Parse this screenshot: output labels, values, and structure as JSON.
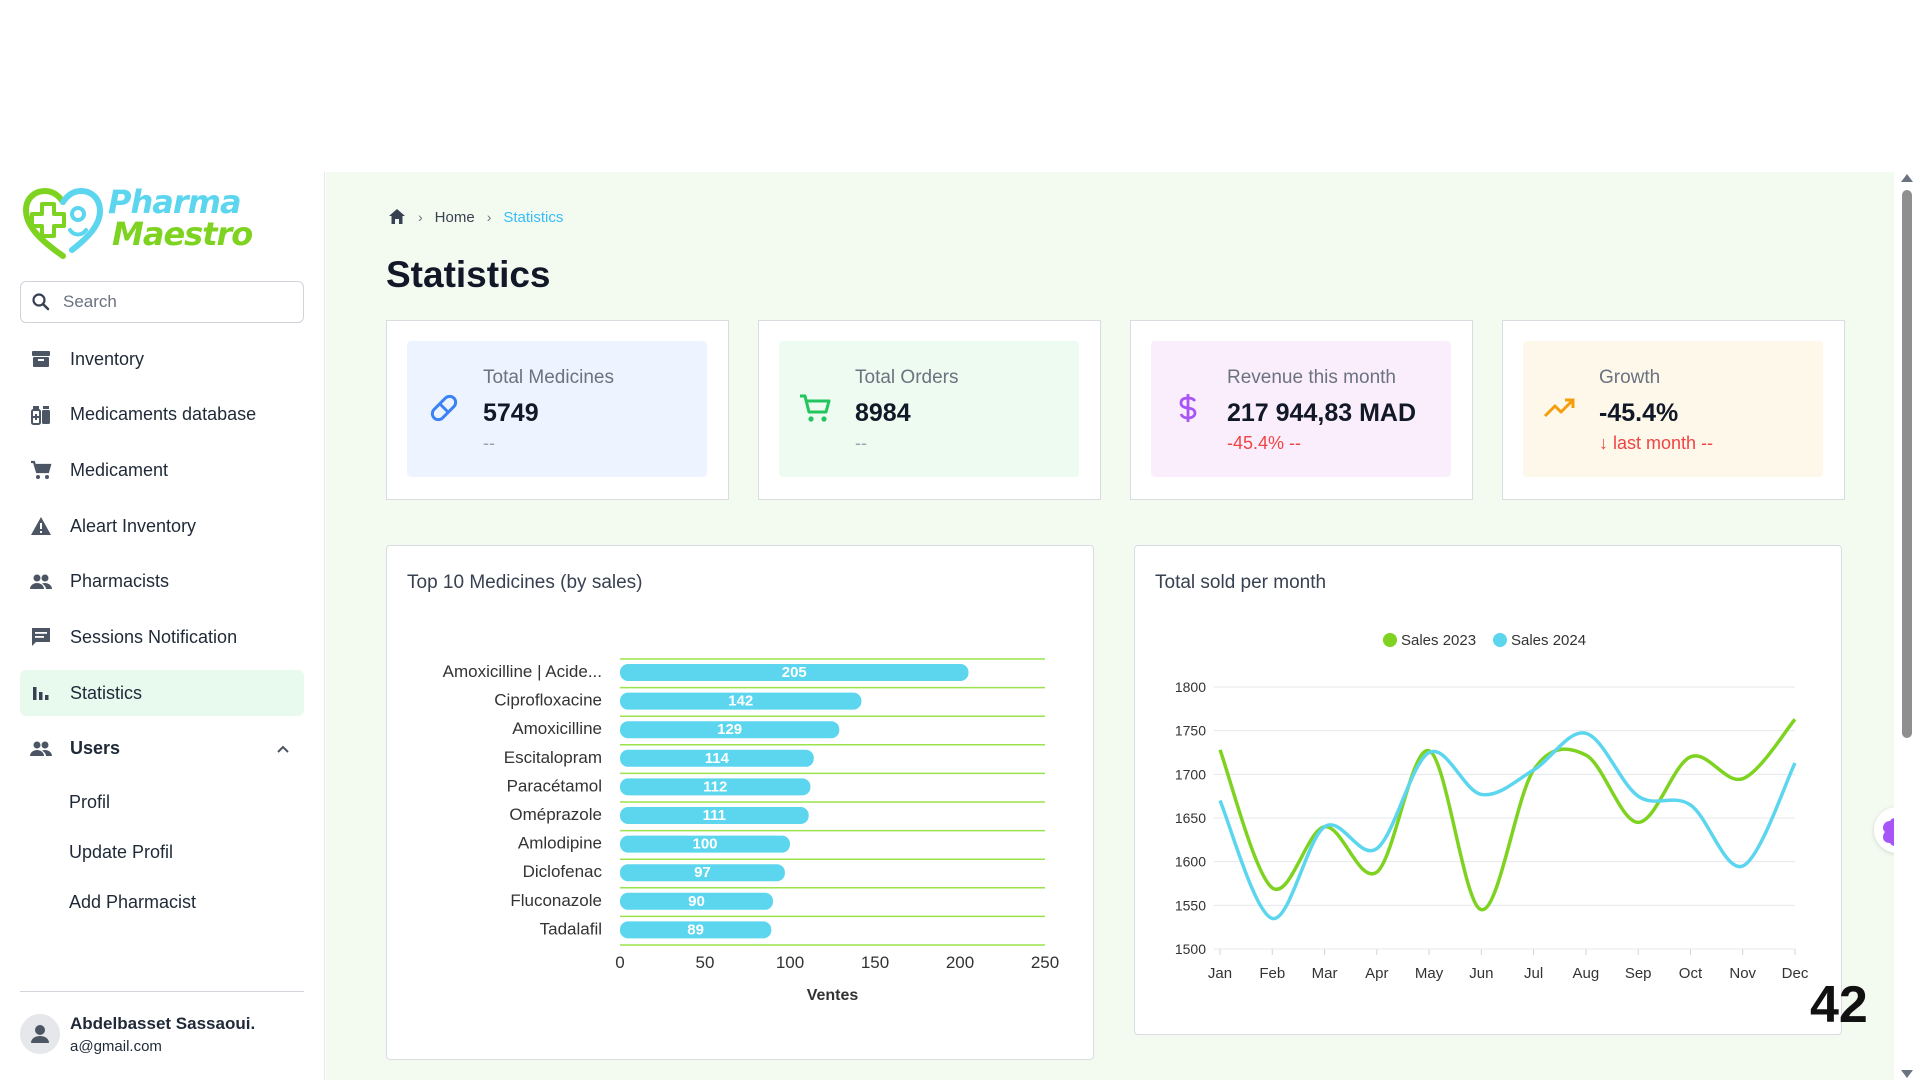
{
  "brand": {
    "line1": "Pharma",
    "line2": "Maestro"
  },
  "search": {
    "placeholder": "Search"
  },
  "sidebar": {
    "items": [
      {
        "label": "Inventory",
        "icon": "archive-icon"
      },
      {
        "label": "Medicaments database",
        "icon": "bottles-icon"
      },
      {
        "label": "Medicament",
        "icon": "cart-icon"
      },
      {
        "label": "Aleart Inventory",
        "icon": "warning-icon"
      },
      {
        "label": "Pharmacists",
        "icon": "people-icon"
      },
      {
        "label": "Sessions Notification",
        "icon": "chat-icon"
      },
      {
        "label": "Statistics",
        "icon": "bar-chart-icon",
        "active": true
      }
    ],
    "users": {
      "label": "Users",
      "icon": "people-icon",
      "expanded": true,
      "sub": [
        "Profil",
        "Update Profil",
        "Add Pharmacist"
      ]
    },
    "user": {
      "name": "Abdelbasset Sassaoui.",
      "email": "a@gmail.com"
    }
  },
  "breadcrumb": {
    "home": "Home",
    "current": "Statistics"
  },
  "page_title": "Statistics",
  "stats": [
    {
      "label": "Total Medicines",
      "value": "5749",
      "sub": "--",
      "icon": "pill-icon",
      "bg": "#eef4ff",
      "color": "#3b82f6"
    },
    {
      "label": "Total Orders",
      "value": "8984",
      "sub": "--",
      "icon": "cart-icon",
      "bg": "#eefbf0",
      "color": "#22c55e"
    },
    {
      "label": "Revenue this month",
      "value": "217 944,83 MAD",
      "sub": "-45.4% --",
      "icon": "dollar-icon",
      "bg": "#fbeefc",
      "color": "#a855f7"
    },
    {
      "label": "Growth",
      "value": "-45.4%",
      "sub": "↓ last month --",
      "icon": "trending-up-icon",
      "bg": "#fef8ea",
      "color": "#f59e0b"
    }
  ],
  "colors": {
    "accent_green": "#7ed321",
    "accent_cyan": "#5bd6ee",
    "negative": "#ef4444"
  },
  "charts": {
    "top10_title": "Top 10 Medicines (by sales)",
    "monthly_title": "Total sold per month"
  },
  "chart_data": [
    {
      "type": "bar",
      "orientation": "horizontal",
      "title": "Top 10 Medicines (by sales)",
      "categories": [
        "Amoxicilline | Acide...",
        "Ciprofloxacine",
        "Amoxicilline",
        "Escitalopram",
        "Paracétamol",
        "Oméprazole",
        "Amlodipine",
        "Diclofenac",
        "Fluconazole",
        "Tadalafil"
      ],
      "values": [
        205,
        142,
        129,
        114,
        112,
        111,
        100,
        97,
        90,
        89
      ],
      "xlabel": "Ventes",
      "ylabel": "",
      "xlim": [
        0,
        250
      ],
      "xticks": [
        0,
        50,
        100,
        150,
        200,
        250
      ],
      "bar_color": "#5bd6ee",
      "grid_color": "#9be34a"
    },
    {
      "type": "line",
      "title": "Total sold per month",
      "x": [
        "Jan",
        "Feb",
        "Mar",
        "Apr",
        "May",
        "Jun",
        "Jul",
        "Aug",
        "Sep",
        "Oct",
        "Nov",
        "Dec"
      ],
      "series": [
        {
          "name": "Sales 2023",
          "color": "#7ed321",
          "values": [
            1728,
            1570,
            1640,
            1588,
            1727,
            1545,
            1705,
            1722,
            1645,
            1720,
            1695,
            1763
          ]
        },
        {
          "name": "Sales 2024",
          "color": "#5bd6ee",
          "values": [
            1670,
            1535,
            1640,
            1615,
            1725,
            1677,
            1705,
            1747,
            1675,
            1665,
            1595,
            1713
          ]
        }
      ],
      "ylim": [
        1500,
        1800
      ],
      "yticks": [
        1500,
        1550,
        1600,
        1650,
        1700,
        1750,
        1800
      ],
      "legend": "top-center",
      "grid": true
    }
  ],
  "page_number": "42"
}
